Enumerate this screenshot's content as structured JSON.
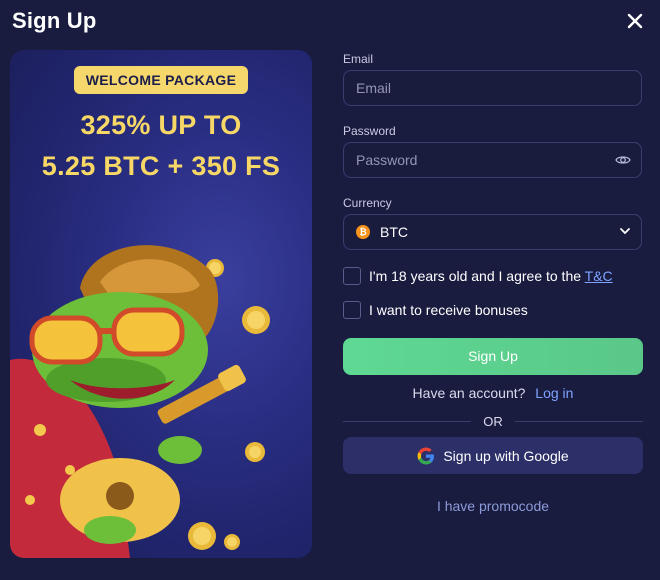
{
  "modal": {
    "title": "Sign Up"
  },
  "promo": {
    "badge": "WELCOME PACKAGE",
    "line1": "325% UP TO",
    "line2": "5.25 BTC + 350 FS"
  },
  "form": {
    "email_label": "Email",
    "email_placeholder": "Email",
    "password_label": "Password",
    "password_placeholder": "Password",
    "currency_label": "Currency",
    "currency_value": "BTC",
    "age_text": "I'm 18 years old and I agree to the ",
    "tc_link": "T&C",
    "bonus_text": "I want to receive bonuses",
    "signup_button": "Sign Up",
    "have_account": "Have an account?",
    "login_link": "Log in",
    "or_text": "OR",
    "google_button": "Sign up with Google",
    "promocode_link": "I have promocode"
  },
  "colors": {
    "background": "#191b3f",
    "accent_green": "#5ed993",
    "promo_yellow": "#f7d866",
    "link_blue": "#7fa3ff"
  },
  "icons": [
    "close-icon",
    "eye-icon",
    "btc-coin-icon",
    "chevron-down-icon",
    "google-icon"
  ]
}
